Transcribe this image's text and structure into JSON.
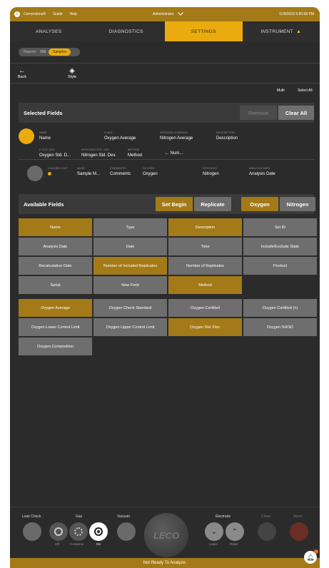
{
  "titlebar": {
    "logo_glyph": "i",
    "app_name": "Cornerstone®",
    "guide": "Guide",
    "help": "Help",
    "user": "Administrator",
    "datetime": "11/9/2022 5:50:56 PM"
  },
  "nav": {
    "tabs": [
      {
        "label": "ANALYSES",
        "active": false
      },
      {
        "label": "DIAGNOSTICS",
        "active": false
      },
      {
        "label": "SETTINGS",
        "active": true
      },
      {
        "label": "INSTRUMENT",
        "active": false,
        "warning": true
      }
    ]
  },
  "toggle": {
    "off": "Reports",
    "on": "ON",
    "selected": "Samples"
  },
  "toolbar": {
    "back": "Back",
    "style": "Style"
  },
  "selection": {
    "multi": "Multi",
    "select_all": "Select All"
  },
  "selected_fields": {
    "title": "Selected Fields",
    "remove": "Remove",
    "clear_all": "Clear All",
    "row1": [
      {
        "label": "NAME",
        "value": "Name"
      },
      {
        "label": "O AVG",
        "value": "Oxygen Average"
      },
      {
        "label": "NITROGEN AVERAGE",
        "value": "Nitrogen Average"
      },
      {
        "label": "DESCRIPTION",
        "value": "Description"
      },
      {
        "label": "O STD. DEV.",
        "value": "Oxygen Std. D..."
      },
      {
        "label": "NITROGEN STD. DEV.",
        "value": "Nitrogen Std. Dev."
      },
      {
        "label": "METHOD",
        "value": "Method"
      },
      {
        "label": "",
        "value": "← Num..."
      }
    ],
    "row2": [
      {
        "label": "COLORED DOT",
        "value": ""
      },
      {
        "label": "MASS",
        "value": "Sample M..."
      },
      {
        "label": "COMMENTS",
        "value": "Comments"
      },
      {
        "label": "OXYGEN",
        "value": "Oxygen"
      },
      {
        "label": "NITROGEN",
        "value": "Nitrogen"
      },
      {
        "label": "ANALYSIS DATE",
        "value": "Analysis Date"
      }
    ]
  },
  "available_fields": {
    "title": "Available Fields",
    "set_begin": "Set Begin",
    "replicate": "Replicate",
    "oxygen": "Oxygen",
    "nitrogen": "Nitrogen",
    "general": [
      {
        "label": "Name",
        "selected": true
      },
      {
        "label": "Type",
        "selected": false
      },
      {
        "label": "Description",
        "selected": true
      },
      {
        "label": "Set ID",
        "selected": false
      },
      {
        "label": "Analysis Date",
        "selected": false
      },
      {
        "label": "Date",
        "selected": false
      },
      {
        "label": "Time",
        "selected": false
      },
      {
        "label": "Include/Exclude State",
        "selected": false
      },
      {
        "label": "Recalculation Date",
        "selected": false
      },
      {
        "label": "Number of Included Replicates",
        "selected": true
      },
      {
        "label": "Number of Replicates",
        "selected": false
      },
      {
        "label": "Product",
        "selected": false
      },
      {
        "label": "Serial",
        "selected": false
      },
      {
        "label": "New Field",
        "selected": false
      },
      {
        "label": "Method",
        "selected": true
      }
    ],
    "oxygen_fields": [
      {
        "label": "Oxygen Average",
        "selected": true
      },
      {
        "label": "Oxygen Check Standard",
        "selected": false
      },
      {
        "label": "Oxygen Certified",
        "selected": false
      },
      {
        "label": "Oxygen Certified (±)",
        "selected": false
      },
      {
        "label": "Oxygen Lower Control Limit",
        "selected": false
      },
      {
        "label": "Oxygen Upper Control Limit",
        "selected": false
      },
      {
        "label": "Oxygen Std. Dev.",
        "selected": true
      },
      {
        "label": "Oxygen %RSD",
        "selected": false
      },
      {
        "label": "Oxygen Composition",
        "selected": false
      }
    ]
  },
  "controls": {
    "leak_check": "Leak Check",
    "gas": "Gas",
    "gas_off": "Off",
    "gas_conserve": "Conserve",
    "gas_on": "On",
    "vacuum": "Vacuum",
    "logo": "LECO",
    "electrode": "Electrode",
    "lower": "Lower",
    "raise": "Raise",
    "clean": "Clean",
    "abort": "Abort"
  },
  "status": {
    "text": "Not Ready To Analyze."
  },
  "colors": {
    "gold": "#a37a17",
    "accent": "#e9ab0e",
    "abort": "#6b2d24"
  }
}
